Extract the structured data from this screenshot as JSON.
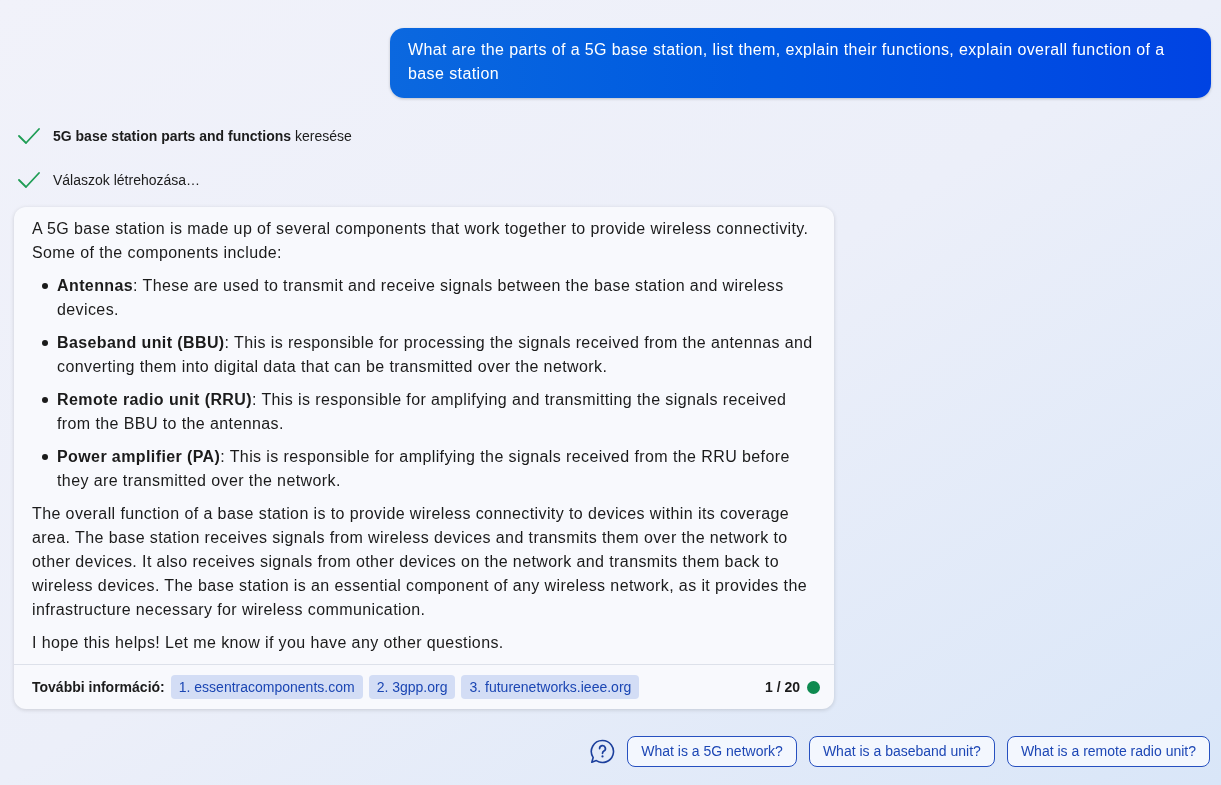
{
  "user_message": {
    "text": "What are the parts of a 5G base station, list them, explain their functions, explain overall function of a base station"
  },
  "progress": [
    {
      "text": "**5G base station parts and functions** keresése",
      "done": true
    },
    {
      "text": "Válaszok létrehozása…",
      "done": true
    }
  ],
  "answer": {
    "blocks": [
      {
        "kind": "paragraph",
        "text": "A 5G base station is made up of several components that work together to provide wireless connectivity. Some of the components include:"
      },
      {
        "kind": "bullet",
        "text": "**Antennas**: These are used to transmit and receive signals between the base station and wireless devices."
      },
      {
        "kind": "bullet",
        "text": "**Baseband unit (BBU)**: This is responsible for processing the signals received from the antennas and converting them into digital data that can be transmitted over the network."
      },
      {
        "kind": "bullet",
        "text": "**Remote radio unit (RRU)**: This is responsible for amplifying and transmitting the signals received from the BBU to the antennas."
      },
      {
        "kind": "bullet",
        "text": "**Power amplifier (PA)**: This is responsible for amplifying the signals received from the RRU before they are transmitted over the network."
      },
      {
        "kind": "paragraph",
        "text": "The overall function of a base station is to provide wireless connectivity to devices within its coverage area. The base station receives signals from wireless devices and transmits them over the network to other devices. It also receives signals from other devices on the network and transmits them back to wireless devices. The base station is an essential component of any wireless network, as it provides the infrastructure necessary for wireless communication."
      },
      {
        "kind": "paragraph",
        "text": "I hope this helps! Let me know if you have any other questions."
      }
    ],
    "footer": {
      "label": "További információ:",
      "sources": [
        "1. essentracomponents.com",
        "2. 3gpp.org",
        "3. futurenetworks.ieee.org"
      ],
      "counter": "1 / 20"
    }
  },
  "suggestions": [
    "What is a 5G network?",
    "What is a baseband unit?",
    "What is a remote radio unit?"
  ]
}
